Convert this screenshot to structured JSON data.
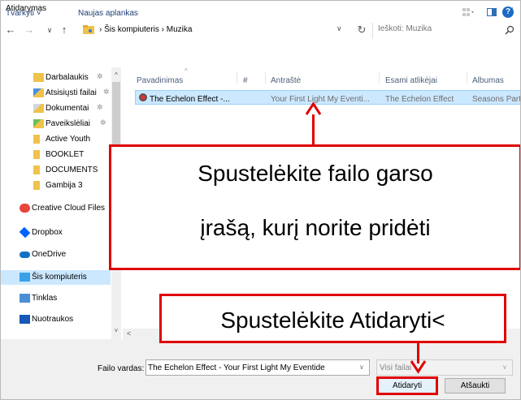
{
  "window": {
    "title": "Atidarymas",
    "close_glyph": "×"
  },
  "navigation": {
    "back_glyph": "←",
    "forward_glyph": "→",
    "recent_glyph": "∨",
    "up_glyph": "↑",
    "path": "›  Šis kompiuteris  ›  Muzika",
    "dropdown_glyph": "∨",
    "refresh_glyph": "↻",
    "search_placeholder": "Ieškoti: Muzika"
  },
  "toolbar": {
    "organize_label": "Tvarkyti ˅",
    "new_folder_label": "Naujas aplankas",
    "help_glyph": "?"
  },
  "nav_pane": {
    "items": [
      {
        "label": "Darbalaukis",
        "icon": "desktop-folder-icon",
        "pinned": true
      },
      {
        "label": "Atsisiųsti failai",
        "icon": "downloads-folder-icon",
        "pinned": true
      },
      {
        "label": "Dokumentai",
        "icon": "documents-folder-icon",
        "pinned": true
      },
      {
        "label": "Paveikslėliai",
        "icon": "pictures-folder-icon",
        "pinned": true
      },
      {
        "label": "Active Youth",
        "icon": "folder-icon",
        "pinned": false
      },
      {
        "label": "BOOKLET",
        "icon": "folder-icon",
        "pinned": false
      },
      {
        "label": "DOCUMENTS",
        "icon": "folder-icon",
        "pinned": false
      },
      {
        "label": "Gambija 3",
        "icon": "folder-icon",
        "pinned": false
      },
      {
        "label": "Creative Cloud Files",
        "icon": "creative-cloud-icon",
        "pinned": false
      },
      {
        "label": "Dropbox",
        "icon": "dropbox-icon",
        "pinned": false
      },
      {
        "label": "OneDrive",
        "icon": "onedrive-icon",
        "pinned": false
      },
      {
        "label": "Šis kompiuteris",
        "icon": "computer-icon",
        "pinned": false,
        "selected": true
      },
      {
        "label": "Tinklas",
        "icon": "network-icon",
        "pinned": false
      },
      {
        "label": "Nuotraukos",
        "icon": "photos-icon",
        "pinned": false
      }
    ],
    "pin_glyph": "✲",
    "scroll_up_glyph": "^",
    "scroll_down_glyph": "˅"
  },
  "file_list": {
    "columns": [
      "Pavadinimas",
      "#",
      "Antraštė",
      "Esami atlikėjai",
      "Albumas"
    ],
    "rows": [
      {
        "name": "The Echelon Effect -...",
        "number": "",
        "title": "Your First  Light My Eventi...",
        "artists": "The Echelon Effect",
        "album": "Seasons Part"
      }
    ],
    "hscroll_left_glyph": "<"
  },
  "bottom": {
    "filename_label": "Failo vardas:",
    "filename_value": "The Echelon Effect - Your First Light My Eventide",
    "filter_value": "Visi failai",
    "dropdown_glyph": "∨",
    "open_label": "Atidaryti",
    "cancel_label": "Atšaukti"
  },
  "annotations": {
    "callout_1_line1": "Spustelėkite failo garso",
    "callout_1_line2": "įrašą, kurį norite pridėti",
    "callout_2": "Spustelėkite Atidaryti<",
    "color": "#e00000"
  },
  "colors": {
    "selection": "#cce8ff",
    "accent": "#1b6ac6"
  }
}
